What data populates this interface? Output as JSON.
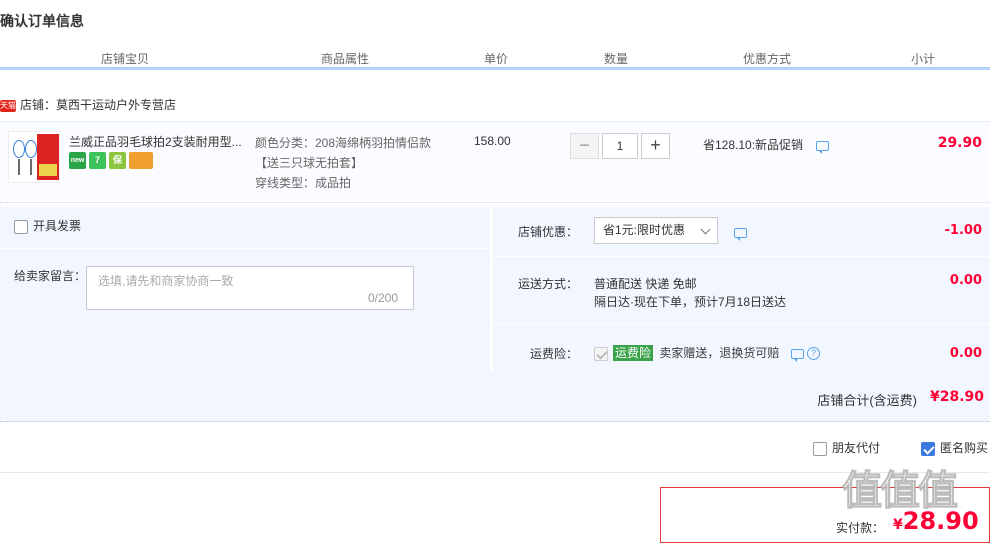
{
  "page": {
    "title": "确认订单信息"
  },
  "columns": [
    "店铺宝贝",
    "商品属性",
    "单价",
    "数量",
    "优惠方式",
    "小计"
  ],
  "shop": {
    "badge": "天猫",
    "label": "店铺：莫西干运动户外专营店"
  },
  "item": {
    "title": "兰威正品羽毛球拍2支装耐用型...",
    "tags": [
      {
        "icon": "new-badge-icon",
        "text": "new",
        "color": "#2aa54a"
      },
      {
        "icon": "seven-day-return-icon",
        "text": "7",
        "color": "#3ec35a"
      },
      {
        "icon": "guarantee-icon",
        "text": "保",
        "color": "#8dc63f"
      },
      {
        "icon": "card-payment-icon",
        "text": "",
        "color": "#f0a030"
      }
    ],
    "attrs": [
      "颜色分类：208海绵柄羽拍情侣款",
      "【送三只球无拍套】",
      "穿线类型：成品拍"
    ],
    "price": "158.00",
    "quantity": "1",
    "qty_minus": "−",
    "qty_plus": "+",
    "promo": "省128.10:新品促销",
    "subtotal": "29.90"
  },
  "invoice": {
    "label": "开具发票"
  },
  "message": {
    "label": "给卖家留言：",
    "placeholder": "选填,请先和商家协商一致",
    "count": "0/200"
  },
  "shop_discount": {
    "label": "店铺优惠：",
    "selected": "省1元:限时优惠",
    "amount": "-1.00"
  },
  "shipping": {
    "label": "运送方式：",
    "line1": "普通配送 快递 免邮",
    "line2": "隔日达·现在下单，预计7月18日送达",
    "amount": "0.00"
  },
  "insurance": {
    "label": "运费险：",
    "tag": "运费险",
    "text": "卖家赠送，退换货可赔",
    "q": "?",
    "amount": "0.00"
  },
  "shop_total": {
    "label": "店铺合计(含运费)",
    "value": "¥28.90"
  },
  "options": {
    "friend_pay": "朋友代付",
    "anonymous": "匿名购买"
  },
  "pay": {
    "label": "实付款：",
    "currency": "¥",
    "value": "28.90"
  },
  "watermark": "值值值"
}
